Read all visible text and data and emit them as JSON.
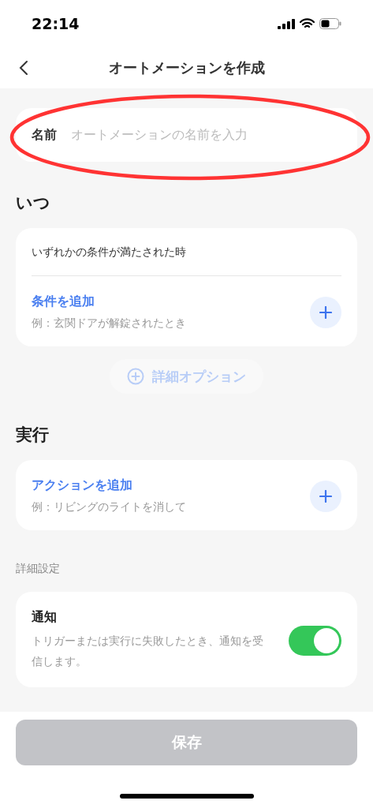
{
  "status_bar": {
    "time": "22:14"
  },
  "nav": {
    "title": "オートメーションを作成"
  },
  "name_field": {
    "label": "名前",
    "placeholder": "オートメーションの名前を入力"
  },
  "when": {
    "heading": "いつ",
    "condition_mode": "いずれかの条件が満たされた時",
    "add": {
      "label": "条件を追加",
      "example": "例：玄関ドアが解錠されたとき"
    },
    "options_button": {
      "label": "詳細オプション",
      "disabled": true
    }
  },
  "execute": {
    "heading": "実行",
    "add": {
      "label": "アクションを追加",
      "example": "例：リビングのライトを消して"
    }
  },
  "advanced": {
    "heading": "詳細設定",
    "notification": {
      "title": "通知",
      "description": "トリガーまたは実行に失敗したとき、通知を受信します。",
      "on": true
    }
  },
  "save_button": {
    "label": "保存",
    "disabled": true
  }
}
